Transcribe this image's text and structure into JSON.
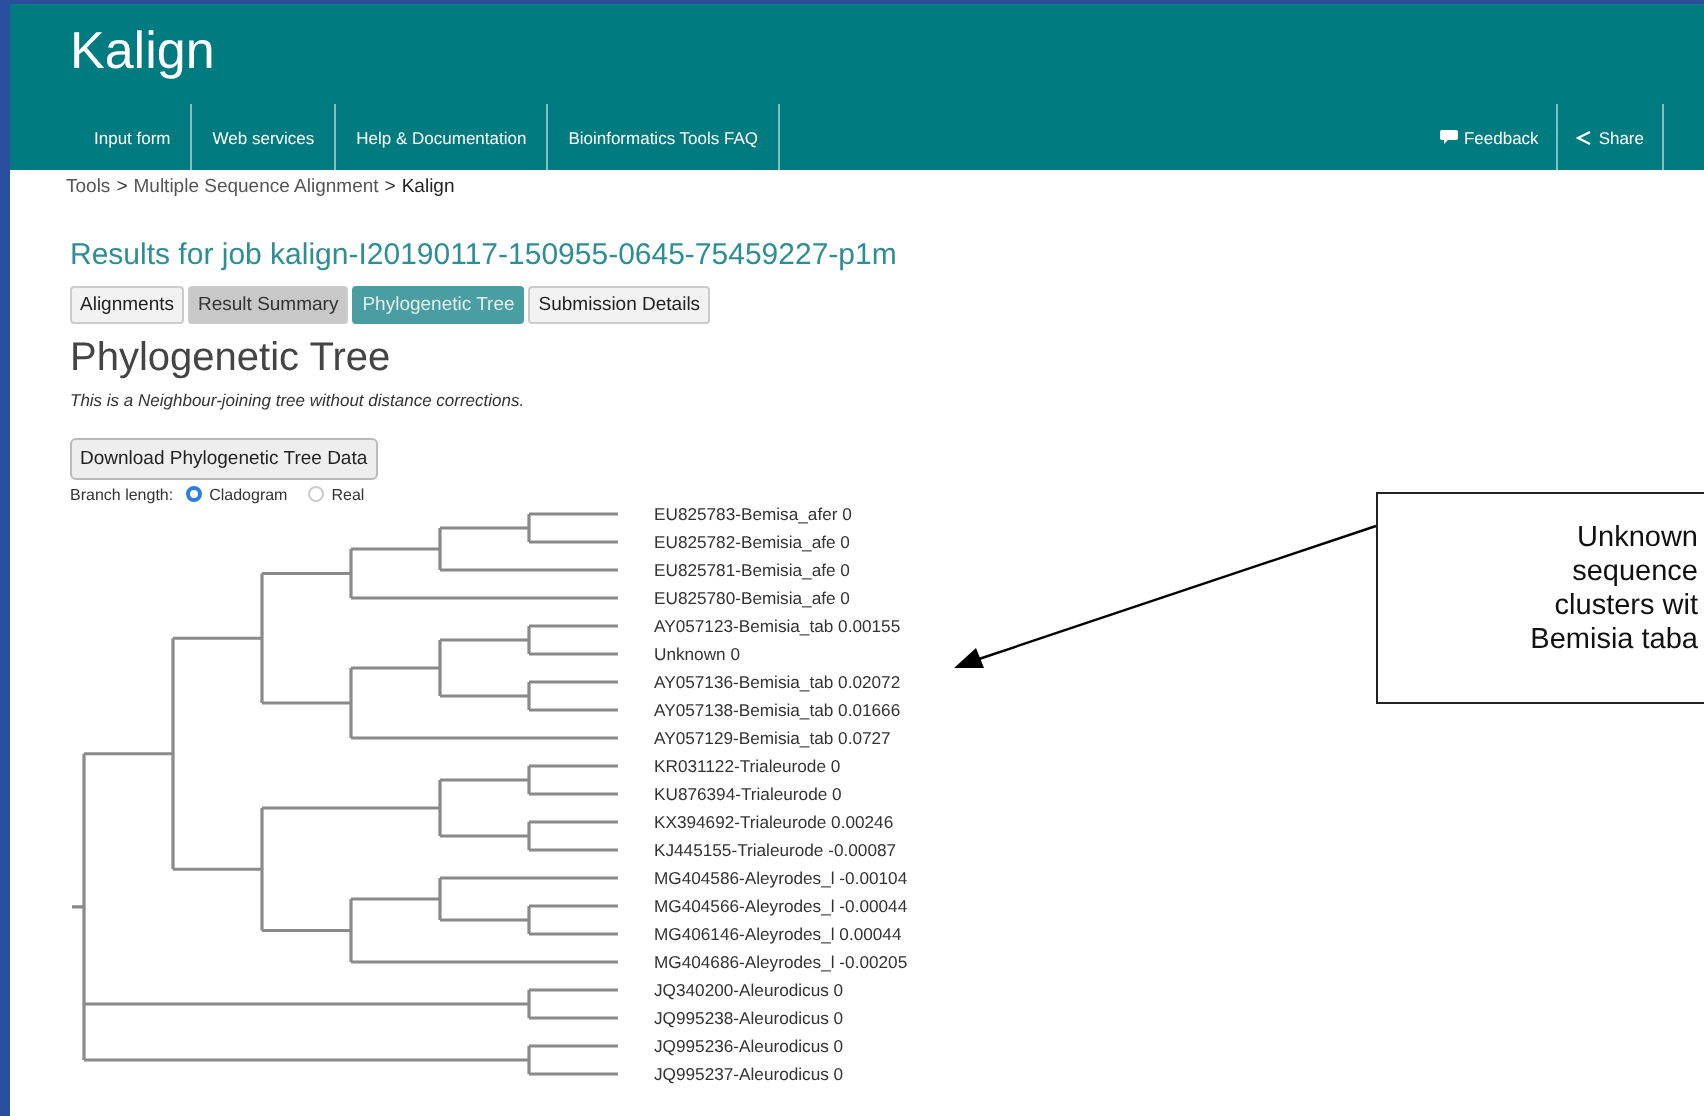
{
  "header": {
    "title": "Kalign"
  },
  "nav": {
    "items": [
      {
        "label": "Input form"
      },
      {
        "label": "Web services"
      },
      {
        "label": "Help & Documentation"
      },
      {
        "label": "Bioinformatics Tools FAQ"
      }
    ],
    "right_items": [
      {
        "label": "Feedback",
        "kind": "feedback"
      },
      {
        "label": "Share",
        "kind": "share"
      }
    ]
  },
  "breadcrumb": [
    {
      "label": "Tools",
      "kind": "link"
    },
    {
      "label": ">",
      "kind": "sep"
    },
    {
      "label": "Multiple Sequence Alignment",
      "kind": "link"
    },
    {
      "label": ">",
      "kind": "sep"
    },
    {
      "label": "Kalign",
      "kind": "current"
    }
  ],
  "job_title": "Results for job kalign-I20190117-150955-0645-75459227-p1m",
  "tabs": [
    {
      "label": "Alignments",
      "selected": false
    },
    {
      "label": "Result Summary",
      "selected": false
    },
    {
      "label": "Phylogenetic Tree",
      "selected": true
    },
    {
      "label": "Submission Details",
      "selected": false
    }
  ],
  "section_title": "Phylogenetic Tree",
  "description": "This is a Neighbour-joining tree without distance corrections.",
  "download_button": "Download Phylogenetic Tree Data",
  "branch_length": {
    "label": "Branch length:",
    "options": [
      {
        "label": "Cladogram",
        "selected": true
      },
      {
        "label": "Real",
        "selected": false
      }
    ]
  },
  "tree": {
    "children": [
      {
        "children": [
          {
            "children": [
              {
                "children": [
                  {
                    "children": [
                      {
                        "children": [
                          {
                            "label": "EU825783-Bemisa_afer 0"
                          },
                          {
                            "label": "EU825782-Bemisia_afe 0"
                          }
                        ]
                      },
                      {
                        "label": "EU825781-Bemisia_afe 0"
                      }
                    ]
                  },
                  {
                    "label": "EU825780-Bemisia_afe 0"
                  }
                ]
              },
              {
                "children": [
                  {
                    "children": [
                      {
                        "children": [
                          {
                            "label": "AY057123-Bemisia_tab 0.00155"
                          },
                          {
                            "label": "Unknown 0"
                          }
                        ]
                      },
                      {
                        "children": [
                          {
                            "label": "AY057136-Bemisia_tab 0.02072"
                          },
                          {
                            "label": "AY057138-Bemisia_tab 0.01666"
                          }
                        ]
                      }
                    ]
                  },
                  {
                    "label": "AY057129-Bemisia_tab 0.0727"
                  }
                ]
              }
            ]
          },
          {
            "children": [
              {
                "children": [
                  {
                    "children": [
                      {
                        "label": "KR031122-Trialeurode 0"
                      },
                      {
                        "label": "KU876394-Trialeurode 0"
                      }
                    ]
                  },
                  {
                    "children": [
                      {
                        "label": "KX394692-Trialeurode 0.00246"
                      },
                      {
                        "label": "KJ445155-Trialeurode -0.00087"
                      }
                    ]
                  }
                ]
              },
              {
                "children": [
                  {
                    "children": [
                      {
                        "label": "MG404586-Aleyrodes_l -0.00104"
                      },
                      {
                        "children": [
                          {
                            "label": "MG404566-Aleyrodes_l -0.00044"
                          },
                          {
                            "label": "MG406146-Aleyrodes_l 0.00044"
                          }
                        ]
                      }
                    ]
                  },
                  {
                    "label": "MG404686-Aleyrodes_l -0.00205"
                  }
                ]
              }
            ]
          }
        ]
      },
      {
        "children": [
          {
            "label": "JQ340200-Aleurodicus 0"
          },
          {
            "label": "JQ995238-Aleurodicus 0"
          }
        ]
      },
      {
        "children": [
          {
            "label": "JQ995236-Aleurodicus 0"
          },
          {
            "label": "JQ995237-Aleurodicus 0"
          }
        ]
      }
    ]
  },
  "callout": {
    "lines": [
      "Unknown",
      "sequence",
      "clusters wit",
      "Bemisia taba"
    ]
  }
}
